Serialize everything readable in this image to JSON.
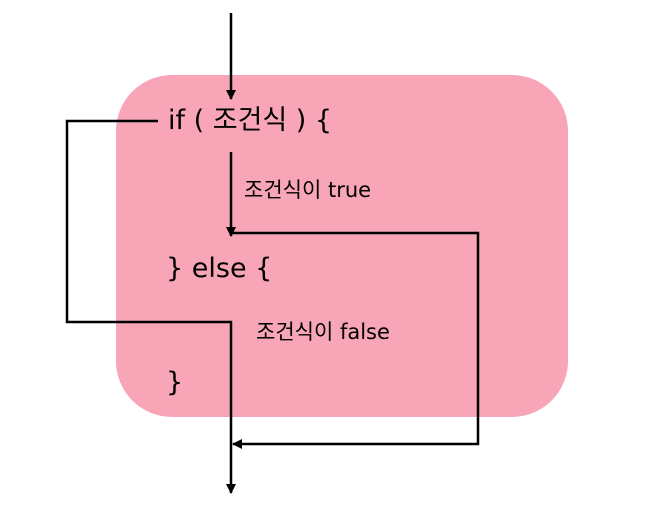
{
  "code": {
    "if_line": "if ( 조건식 ) {",
    "else_line": "} else {",
    "close_line": "}"
  },
  "labels": {
    "true_branch": "조건식이 true",
    "false_branch": "조건식이 false"
  },
  "colors": {
    "block_background": "#f7a5b7",
    "lines": "#000000"
  }
}
